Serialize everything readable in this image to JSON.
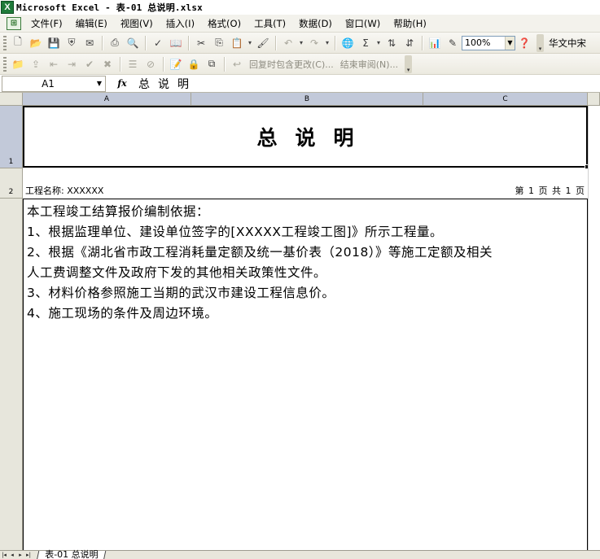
{
  "window": {
    "icon_text": "X",
    "title": "Microsoft Excel - 表-01 总说明.xlsx"
  },
  "menu": {
    "items": [
      "文件(F)",
      "编辑(E)",
      "视图(V)",
      "插入(I)",
      "格式(O)",
      "工具(T)",
      "数据(D)",
      "窗口(W)",
      "帮助(H)"
    ]
  },
  "toolbar": {
    "zoom": "100%",
    "font": "华文中宋",
    "reply_changes": "回复时包含更改(C)...",
    "end_review": "结束审阅(N)..."
  },
  "formula_bar": {
    "name_box": "A1",
    "fx_label": "fx",
    "content": "总说明"
  },
  "columns": [
    "A",
    "B",
    "C"
  ],
  "rows": [
    "1",
    "2"
  ],
  "sheet": {
    "title": "总说明",
    "project_label": "工程名称:  XXXXXX",
    "page_info": "第 1 页 共 1 页",
    "lines": [
      "本工程竣工结算报价编制依据：",
      "1、根据监理单位、建设单位签字的[XXXXX工程竣工图]》所示工程量。",
      "2、根据《湖北省市政工程消耗量定额及统一基价表（2018）》等施工定额及相关",
      "人工费调整文件及政府下发的其他相关政策性文件。",
      "3、材料价格参照施工当期的武汉市建设工程信息价。",
      "4、施工现场的条件及周边环境。"
    ]
  },
  "tabs": {
    "active": "表-01 总说明"
  },
  "colors": {
    "header_fill": "#e7e6dc",
    "header_selected": "#c2c9d9",
    "toolbar_bg": "#f3f2ec"
  }
}
